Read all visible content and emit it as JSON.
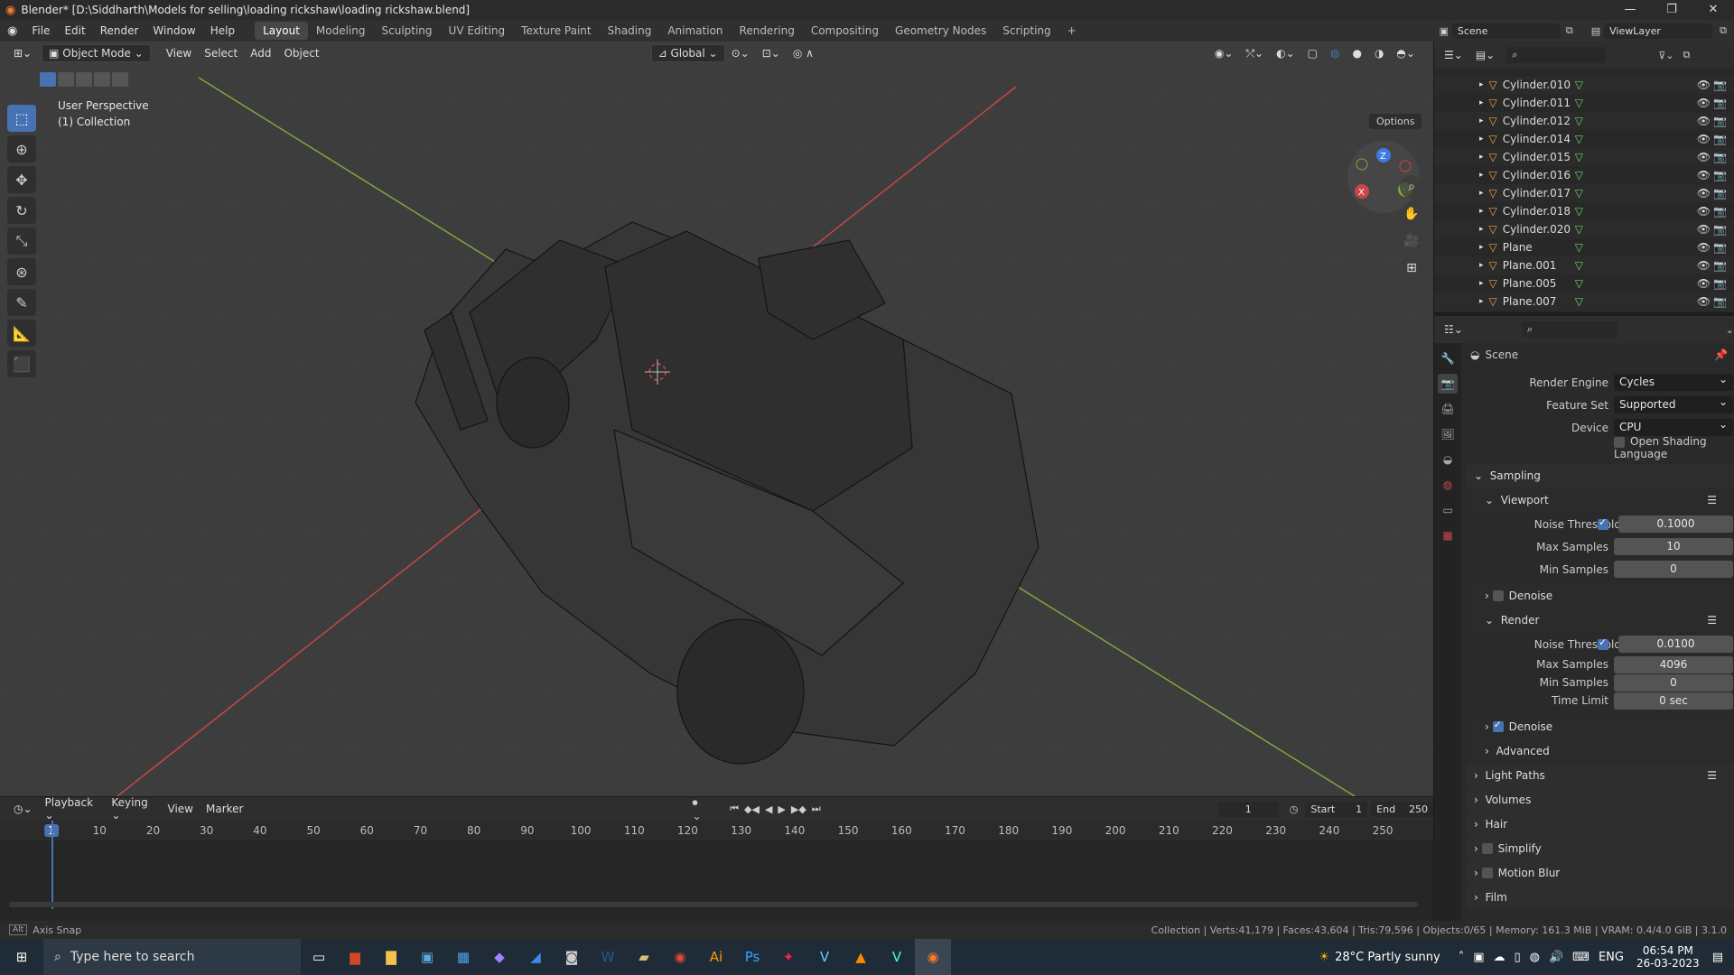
{
  "window": {
    "title": "Blender* [D:\\Siddharth\\Models for selling\\loading rickshaw\\loading rickshaw.blend]",
    "minimize": "—",
    "maximize": "❐",
    "close": "✕"
  },
  "menu": {
    "items": [
      "File",
      "Edit",
      "Render",
      "Window",
      "Help"
    ],
    "workspaces": [
      "Layout",
      "Modeling",
      "Sculpting",
      "UV Editing",
      "Texture Paint",
      "Shading",
      "Animation",
      "Rendering",
      "Compositing",
      "Geometry Nodes",
      "Scripting",
      "+"
    ],
    "active_workspace": "Layout",
    "scene": "Scene",
    "view_layer": "ViewLayer"
  },
  "viewport": {
    "mode": "Object Mode",
    "menus": [
      "View",
      "Select",
      "Add",
      "Object"
    ],
    "orientation": "Global",
    "options": "Options",
    "perspective": "User Perspective",
    "collection": "(1) Collection",
    "gizmo": {
      "x": "X",
      "y": "Y",
      "z": "Z"
    }
  },
  "timeline": {
    "menus": [
      "Playback",
      "Keying",
      "View",
      "Marker"
    ],
    "current_frame": "1",
    "start_label": "Start",
    "start": "1",
    "end_label": "End",
    "end": "250",
    "ruler": [
      "1",
      "10",
      "20",
      "30",
      "40",
      "50",
      "60",
      "70",
      "80",
      "90",
      "100",
      "110",
      "120",
      "130",
      "140",
      "150",
      "160",
      "170",
      "180",
      "190",
      "200",
      "210",
      "220",
      "230",
      "240",
      "250"
    ]
  },
  "outliner": {
    "items": [
      "Cylinder.010",
      "Cylinder.011",
      "Cylinder.012",
      "Cylinder.014",
      "Cylinder.015",
      "Cylinder.016",
      "Cylinder.017",
      "Cylinder.018",
      "Cylinder.020",
      "Plane",
      "Plane.001",
      "Plane.005",
      "Plane.007"
    ]
  },
  "properties": {
    "context": "Scene",
    "render_engine_label": "Render Engine",
    "render_engine": "Cycles",
    "feature_set_label": "Feature Set",
    "feature_set": "Supported",
    "device_label": "Device",
    "device": "CPU",
    "osl": "Open Shading Language",
    "sampling": "Sampling",
    "viewport": "Viewport",
    "noise_threshold_label": "Noise Threshold",
    "vp_noise": "0.1000",
    "max_samples_label": "Max Samples",
    "vp_max": "10",
    "min_samples_label": "Min Samples",
    "vp_min": "0",
    "denoise": "Denoise",
    "render": "Render",
    "r_noise": "0.0100",
    "r_max": "4096",
    "r_min": "0",
    "time_limit_label": "Time Limit",
    "r_time": "0 sec",
    "advanced": "Advanced",
    "light_paths": "Light Paths",
    "volumes": "Volumes",
    "hair": "Hair",
    "simplify": "Simplify",
    "motion_blur": "Motion Blur",
    "film": "Film"
  },
  "status": {
    "left": "Axis Snap",
    "right": "Collection | Verts:41,179 | Faces:43,604 | Tris:79,596 | Objects:0/65 | Memory: 161.3 MiB | VRAM: 0.4/4.0 GiB | 3.1.0"
  },
  "taskbar": {
    "search_placeholder": "Type here to search",
    "weather": "28°C  Partly sunny",
    "lang": "ENG",
    "time": "06:54 PM",
    "date": "26-03-2023"
  },
  "colors": {
    "accent": "#4772b3",
    "x_axis": "#c84646",
    "y_axis": "#7ea83b",
    "z_axis": "#3d7be0"
  }
}
